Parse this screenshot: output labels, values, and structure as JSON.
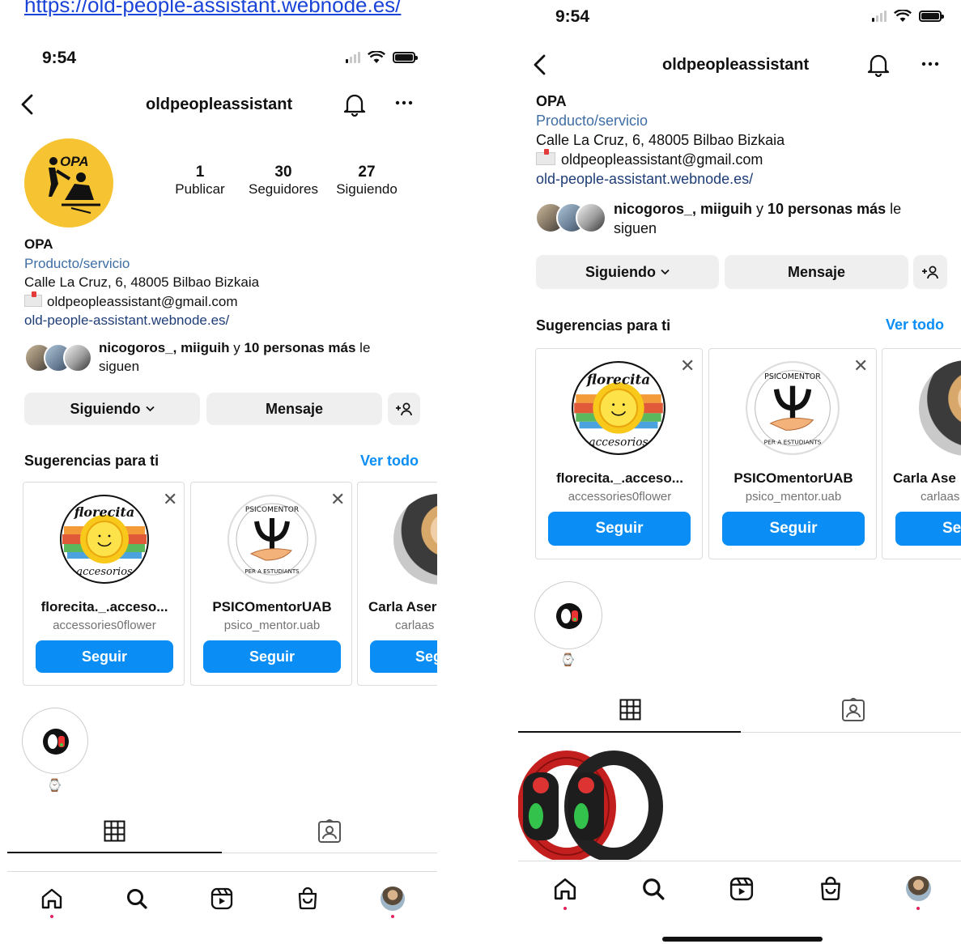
{
  "top_link": "https://old-people-assistant.webnode.es/",
  "status": {
    "time": "9:54"
  },
  "header": {
    "username": "oldpeopleassistant"
  },
  "stats": [
    {
      "value": "1",
      "label": "Publicar"
    },
    {
      "value": "30",
      "label": "Seguidores"
    },
    {
      "value": "27",
      "label": "Siguiendo"
    }
  ],
  "bio": {
    "name": "OPA",
    "category": "Producto/servicio",
    "address": "Calle La Cruz, 6, 48005 Bilbao Bizkaia",
    "email": "oldpeopleassistant@gmail.com",
    "website": "old-people-assistant.webnode.es/"
  },
  "followed_by": {
    "users": "nicogoros_, miiguih",
    "connector": " y ",
    "others": "10 personas más",
    "suffix_line1": " le",
    "suffix_line2": "siguen"
  },
  "actions": {
    "following": "Siguiendo",
    "message": "Mensaje",
    "add_person": "+ꕤ"
  },
  "suggestions": {
    "title": "Sugerencias para ti",
    "see_all": "Ver todo",
    "cards": [
      {
        "name": "florecita._.acceso...",
        "handle": "accessories0flower",
        "button": "Seguir",
        "logo_text_top": "florecita",
        "logo_text_bottom": "accesorios"
      },
      {
        "name": "PSICOmentorUAB",
        "handle": "psico_mentor.uab",
        "button": "Seguir",
        "logo_text_top": "PSICOMENTOR",
        "logo_text_bottom": "PER A ESTUDIANTS"
      },
      {
        "name": "Carla Aser",
        "handle": "carlaas",
        "button": "Seguir"
      }
    ],
    "cards_right": [
      {
        "name": "florecita._.acceso...",
        "handle": "accessories0flower",
        "button": "Seguir"
      },
      {
        "name": "PSICOmentorUAB",
        "handle": "psico_mentor.uab",
        "button": "Seguir"
      },
      {
        "name": "Carla Ase",
        "handle": "carlaas",
        "button": "Se"
      }
    ]
  },
  "logo": {
    "text": "OPA"
  },
  "highlight": {
    "label": "⌚"
  },
  "colors": {
    "accent": "#0a8ef5",
    "category": "#3f6ea5",
    "link": "#1e3d76",
    "logo_bg": "#f6c332",
    "notification": "#e0245e"
  },
  "icons": [
    "back-icon",
    "bell-icon",
    "more-icon",
    "chevron-down-icon",
    "add-person-icon",
    "close-icon",
    "grid-icon",
    "tagged-icon",
    "home-icon",
    "search-icon",
    "reels-icon",
    "shop-icon",
    "profile-icon"
  ]
}
